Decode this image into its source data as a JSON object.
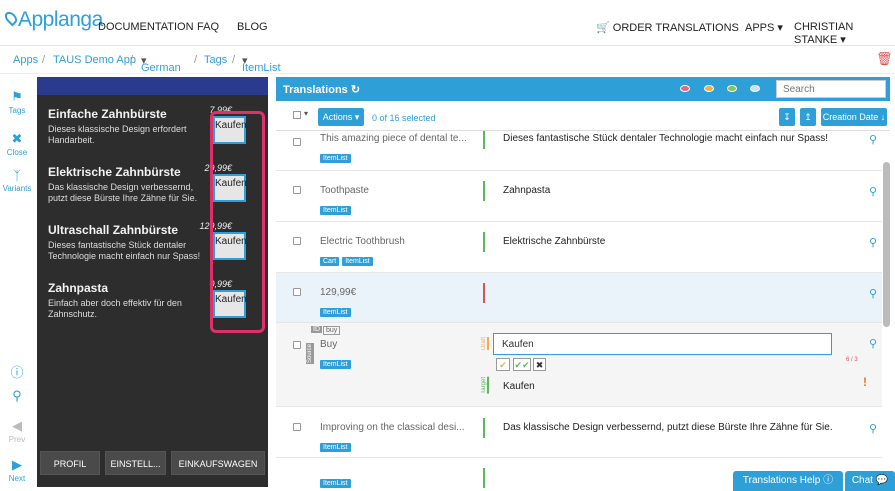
{
  "nav": {
    "logo": "Applanga",
    "links": [
      "DOCUMENTATION",
      "FAQ",
      "BLOG"
    ],
    "order": "ORDER TRANSLATIONS",
    "apps": "APPS",
    "user": "CHRISTIAN STANKE"
  },
  "breadcrumb": [
    "Apps",
    "TAUS Demo App",
    "German",
    "Tags",
    "ItemList"
  ],
  "sidebar": {
    "tags": "Tags",
    "close": "Close",
    "variants": "Variants",
    "prev": "Prev",
    "next": "Next"
  },
  "preview": {
    "products": [
      {
        "name": "Einfache Zahnbürste",
        "desc": "Dieses klassische Design erfordert Handarbeit.",
        "price": "7,99€",
        "button": "Kaufen"
      },
      {
        "name": "Elektrische Zahnbürste",
        "desc": "Das klassische Design verbessernd, putzt diese Bürste Ihre Zähne für Sie.",
        "price": "29,99€",
        "button": "Kaufen"
      },
      {
        "name": "Ultraschall Zahnbürste",
        "desc": "Dieses fantastische Stück dentaler Technologie macht einfach nur Spass!",
        "price": "129,99€",
        "button": "Kaufen"
      },
      {
        "name": "Zahnpasta",
        "desc": "Einfach aber doch effektiv für den Zahnschutz.",
        "price": "0,99€",
        "button": "Kaufen"
      }
    ],
    "buttons": [
      "PROFIL",
      "EINSTELL...",
      "EINKAUFSWAGEN"
    ]
  },
  "translations": {
    "title": "Translations",
    "search_placeholder": "Search",
    "actions": "Actions",
    "selected": "0 of 16 selected",
    "sort": "Creation Date",
    "rows": [
      {
        "source": "This amazing piece of dental te...",
        "target": "Dieses fantastische Stück dentaler Technologie macht einfach nur Spass!",
        "tags": [
          "ItemList"
        ]
      },
      {
        "source": "Toothpaste",
        "target": "Zahnpasta",
        "tags": [
          "ItemList"
        ]
      },
      {
        "source": "Electric Toothbrush",
        "target": "Elektrische Zahnbürste",
        "tags": [
          "Cart",
          "ItemList"
        ]
      },
      {
        "source": "129,99€",
        "target": "",
        "tags": [
          "ItemList"
        ]
      },
      {
        "source": "Buy",
        "target": "Kaufen",
        "tags": [
          "ItemList"
        ],
        "id": "buy",
        "draft": "Kaufen",
        "count": "6 / 3",
        "source_label": "Source",
        "draft_label": "Draft",
        "target_label": "Target",
        "id_label": "ID"
      },
      {
        "source": "Improving on the classical desi...",
        "target": "Das klassische Design verbessernd, putzt diese Bürste Ihre Zähne für Sie.",
        "tags": [
          "ItemList"
        ]
      },
      {
        "source": "",
        "target": "",
        "tags": [
          "ItemList"
        ]
      }
    ]
  },
  "help": "Translations Help",
  "chat": "Chat",
  "colors": {
    "accent": "#2f9fd8",
    "highlight": "#e0306a",
    "ok": "#5cb85c",
    "missing": "#d9534f",
    "draft": "#f0ad4e"
  }
}
